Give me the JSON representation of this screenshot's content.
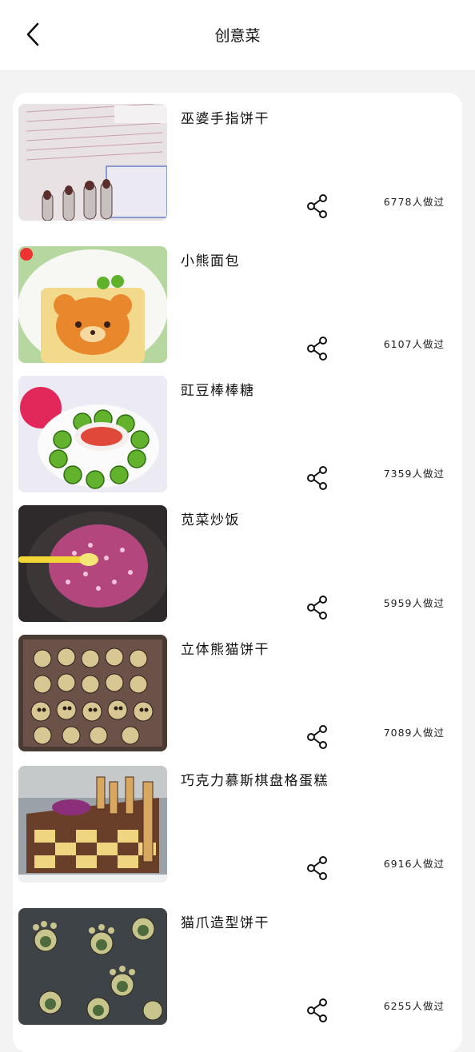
{
  "header": {
    "title": "创意菜",
    "back_icon": "chevron-left-icon"
  },
  "recipes": [
    {
      "name": "巫婆手指饼干",
      "count": "6778人做过",
      "share_icon": "share-icon"
    },
    {
      "name": "小熊面包",
      "count": "6107人做过",
      "share_icon": "share-icon"
    },
    {
      "name": "豇豆棒棒糖",
      "count": "7359人做过",
      "share_icon": "share-icon"
    },
    {
      "name": "苋菜炒饭",
      "count": "5959人做过",
      "share_icon": "share-icon"
    },
    {
      "name": "立体熊猫饼干",
      "count": "7089人做过",
      "share_icon": "share-icon"
    },
    {
      "name": "巧克力慕斯棋盘格蛋糕",
      "count": "6916人做过",
      "share_icon": "share-icon"
    },
    {
      "name": "猫爪造型饼干",
      "count": "6255人做过",
      "share_icon": "share-icon"
    }
  ],
  "colors": {
    "background": "#f3f3f3",
    "card": "#ffffff",
    "text": "#111111"
  }
}
